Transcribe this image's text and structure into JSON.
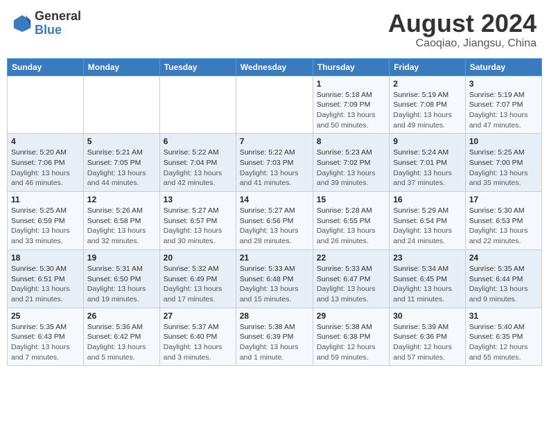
{
  "header": {
    "logo_line1": "General",
    "logo_line2": "Blue",
    "month_year": "August 2024",
    "location": "Caoqiao, Jiangsu, China"
  },
  "weekdays": [
    "Sunday",
    "Monday",
    "Tuesday",
    "Wednesday",
    "Thursday",
    "Friday",
    "Saturday"
  ],
  "weeks": [
    [
      {
        "day": "",
        "info": ""
      },
      {
        "day": "",
        "info": ""
      },
      {
        "day": "",
        "info": ""
      },
      {
        "day": "",
        "info": ""
      },
      {
        "day": "1",
        "sunrise": "5:18 AM",
        "sunset": "7:09 PM",
        "daylight": "13 hours and 50 minutes."
      },
      {
        "day": "2",
        "sunrise": "5:19 AM",
        "sunset": "7:08 PM",
        "daylight": "13 hours and 49 minutes."
      },
      {
        "day": "3",
        "sunrise": "5:19 AM",
        "sunset": "7:07 PM",
        "daylight": "13 hours and 47 minutes."
      }
    ],
    [
      {
        "day": "4",
        "sunrise": "5:20 AM",
        "sunset": "7:06 PM",
        "daylight": "13 hours and 46 minutes."
      },
      {
        "day": "5",
        "sunrise": "5:21 AM",
        "sunset": "7:05 PM",
        "daylight": "13 hours and 44 minutes."
      },
      {
        "day": "6",
        "sunrise": "5:22 AM",
        "sunset": "7:04 PM",
        "daylight": "13 hours and 42 minutes."
      },
      {
        "day": "7",
        "sunrise": "5:22 AM",
        "sunset": "7:03 PM",
        "daylight": "13 hours and 41 minutes."
      },
      {
        "day": "8",
        "sunrise": "5:23 AM",
        "sunset": "7:02 PM",
        "daylight": "13 hours and 39 minutes."
      },
      {
        "day": "9",
        "sunrise": "5:24 AM",
        "sunset": "7:01 PM",
        "daylight": "13 hours and 37 minutes."
      },
      {
        "day": "10",
        "sunrise": "5:25 AM",
        "sunset": "7:00 PM",
        "daylight": "13 hours and 35 minutes."
      }
    ],
    [
      {
        "day": "11",
        "sunrise": "5:25 AM",
        "sunset": "6:59 PM",
        "daylight": "13 hours and 33 minutes."
      },
      {
        "day": "12",
        "sunrise": "5:26 AM",
        "sunset": "6:58 PM",
        "daylight": "13 hours and 32 minutes."
      },
      {
        "day": "13",
        "sunrise": "5:27 AM",
        "sunset": "6:57 PM",
        "daylight": "13 hours and 30 minutes."
      },
      {
        "day": "14",
        "sunrise": "5:27 AM",
        "sunset": "6:56 PM",
        "daylight": "13 hours and 28 minutes."
      },
      {
        "day": "15",
        "sunrise": "5:28 AM",
        "sunset": "6:55 PM",
        "daylight": "13 hours and 26 minutes."
      },
      {
        "day": "16",
        "sunrise": "5:29 AM",
        "sunset": "6:54 PM",
        "daylight": "13 hours and 24 minutes."
      },
      {
        "day": "17",
        "sunrise": "5:30 AM",
        "sunset": "6:53 PM",
        "daylight": "13 hours and 22 minutes."
      }
    ],
    [
      {
        "day": "18",
        "sunrise": "5:30 AM",
        "sunset": "6:51 PM",
        "daylight": "13 hours and 21 minutes."
      },
      {
        "day": "19",
        "sunrise": "5:31 AM",
        "sunset": "6:50 PM",
        "daylight": "13 hours and 19 minutes."
      },
      {
        "day": "20",
        "sunrise": "5:32 AM",
        "sunset": "6:49 PM",
        "daylight": "13 hours and 17 minutes."
      },
      {
        "day": "21",
        "sunrise": "5:33 AM",
        "sunset": "6:48 PM",
        "daylight": "13 hours and 15 minutes."
      },
      {
        "day": "22",
        "sunrise": "5:33 AM",
        "sunset": "6:47 PM",
        "daylight": "13 hours and 13 minutes."
      },
      {
        "day": "23",
        "sunrise": "5:34 AM",
        "sunset": "6:45 PM",
        "daylight": "13 hours and 11 minutes."
      },
      {
        "day": "24",
        "sunrise": "5:35 AM",
        "sunset": "6:44 PM",
        "daylight": "13 hours and 9 minutes."
      }
    ],
    [
      {
        "day": "25",
        "sunrise": "5:35 AM",
        "sunset": "6:43 PM",
        "daylight": "13 hours and 7 minutes."
      },
      {
        "day": "26",
        "sunrise": "5:36 AM",
        "sunset": "6:42 PM",
        "daylight": "13 hours and 5 minutes."
      },
      {
        "day": "27",
        "sunrise": "5:37 AM",
        "sunset": "6:40 PM",
        "daylight": "13 hours and 3 minutes."
      },
      {
        "day": "28",
        "sunrise": "5:38 AM",
        "sunset": "6:39 PM",
        "daylight": "13 hours and 1 minute."
      },
      {
        "day": "29",
        "sunrise": "5:38 AM",
        "sunset": "6:38 PM",
        "daylight": "12 hours and 59 minutes."
      },
      {
        "day": "30",
        "sunrise": "5:39 AM",
        "sunset": "6:36 PM",
        "daylight": "12 hours and 57 minutes."
      },
      {
        "day": "31",
        "sunrise": "5:40 AM",
        "sunset": "6:35 PM",
        "daylight": "12 hours and 55 minutes."
      }
    ]
  ]
}
